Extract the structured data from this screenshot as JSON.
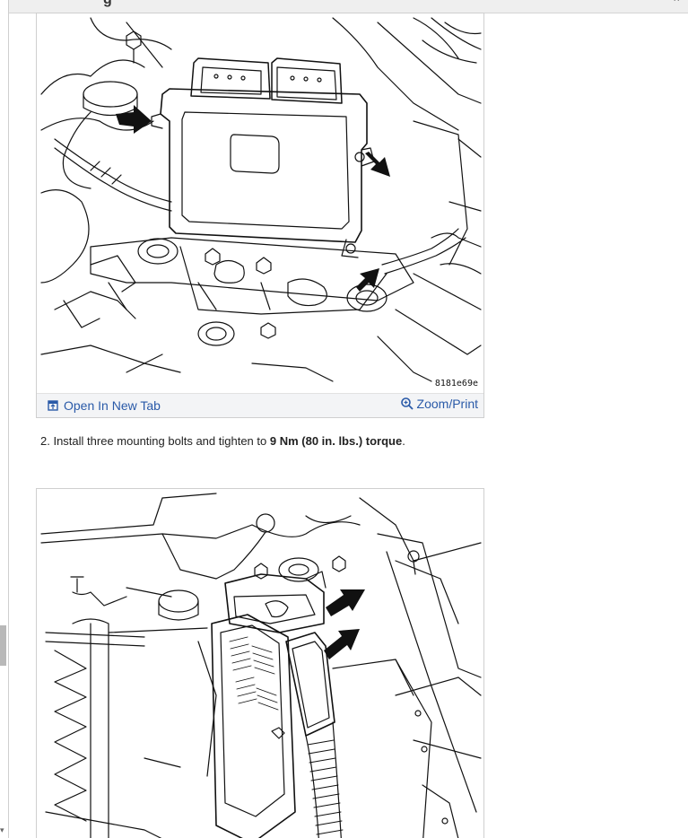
{
  "header": {
    "title": "g",
    "chevron": "^"
  },
  "figure1": {
    "code": "8181e69e",
    "open_in_new_tab_label": "Open In New Tab",
    "zoom_print_label": "Zoom/Print"
  },
  "step2": {
    "number": "2.",
    "text_before": "Install three mounting bolts and tighten to",
    "text_bold": "9 Nm (80 in. lbs.) torque",
    "text_after": "."
  },
  "icons": {
    "open_tab": "open-in-new-tab-icon",
    "zoom": "zoom-magnifier-icon",
    "arrow": "callout-arrow-icon"
  },
  "colors": {
    "link": "#2a5aa8",
    "footer_bg": "#f3f4f6",
    "line_art": "#111111"
  }
}
